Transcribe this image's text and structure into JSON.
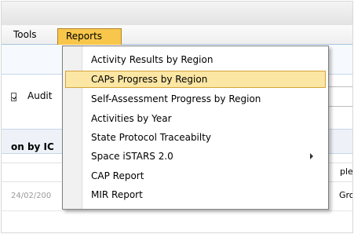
{
  "menubar": {
    "tools_label": "Tools",
    "reports_label": "Reports"
  },
  "background": {
    "audit_label": "Audit",
    "section_title": "on by IC",
    "cell_right_text": "plem",
    "date_text": "24/02/200",
    "group_text": "Gro"
  },
  "colors": {
    "active_menu": "#f8c64a",
    "hover_item": "#fbe6a4"
  },
  "reports_menu": {
    "items": [
      {
        "label": "Activity Results by Region"
      },
      {
        "label": "CAPs Progress by Region"
      },
      {
        "label": "Self-Assessment Progress by Region"
      },
      {
        "label": "Activities by Year"
      },
      {
        "label": "State Protocol Traceabilty"
      },
      {
        "label": "Space iSTARS 2.0",
        "submenu": true
      },
      {
        "label": "CAP Report"
      },
      {
        "label": "MIR Report"
      }
    ],
    "highlighted_index": 1
  }
}
